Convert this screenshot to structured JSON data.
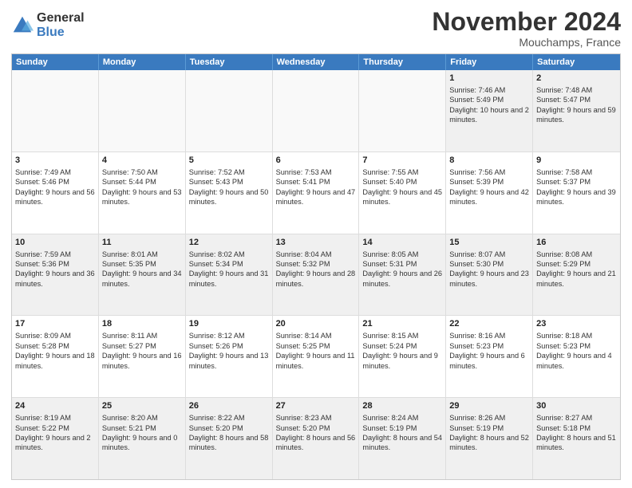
{
  "logo": {
    "general": "General",
    "blue": "Blue"
  },
  "header": {
    "title": "November 2024",
    "subtitle": "Mouchamps, France"
  },
  "calendar": {
    "days": [
      "Sunday",
      "Monday",
      "Tuesday",
      "Wednesday",
      "Thursday",
      "Friday",
      "Saturday"
    ],
    "rows": [
      [
        {
          "day": "",
          "info": "",
          "empty": true
        },
        {
          "day": "",
          "info": "",
          "empty": true
        },
        {
          "day": "",
          "info": "",
          "empty": true
        },
        {
          "day": "",
          "info": "",
          "empty": true
        },
        {
          "day": "",
          "info": "",
          "empty": true
        },
        {
          "day": "1",
          "info": "Sunrise: 7:46 AM\nSunset: 5:49 PM\nDaylight: 10 hours and 2 minutes."
        },
        {
          "day": "2",
          "info": "Sunrise: 7:48 AM\nSunset: 5:47 PM\nDaylight: 9 hours and 59 minutes."
        }
      ],
      [
        {
          "day": "3",
          "info": "Sunrise: 7:49 AM\nSunset: 5:46 PM\nDaylight: 9 hours and 56 minutes."
        },
        {
          "day": "4",
          "info": "Sunrise: 7:50 AM\nSunset: 5:44 PM\nDaylight: 9 hours and 53 minutes."
        },
        {
          "day": "5",
          "info": "Sunrise: 7:52 AM\nSunset: 5:43 PM\nDaylight: 9 hours and 50 minutes."
        },
        {
          "day": "6",
          "info": "Sunrise: 7:53 AM\nSunset: 5:41 PM\nDaylight: 9 hours and 47 minutes."
        },
        {
          "day": "7",
          "info": "Sunrise: 7:55 AM\nSunset: 5:40 PM\nDaylight: 9 hours and 45 minutes."
        },
        {
          "day": "8",
          "info": "Sunrise: 7:56 AM\nSunset: 5:39 PM\nDaylight: 9 hours and 42 minutes."
        },
        {
          "day": "9",
          "info": "Sunrise: 7:58 AM\nSunset: 5:37 PM\nDaylight: 9 hours and 39 minutes."
        }
      ],
      [
        {
          "day": "10",
          "info": "Sunrise: 7:59 AM\nSunset: 5:36 PM\nDaylight: 9 hours and 36 minutes."
        },
        {
          "day": "11",
          "info": "Sunrise: 8:01 AM\nSunset: 5:35 PM\nDaylight: 9 hours and 34 minutes."
        },
        {
          "day": "12",
          "info": "Sunrise: 8:02 AM\nSunset: 5:34 PM\nDaylight: 9 hours and 31 minutes."
        },
        {
          "day": "13",
          "info": "Sunrise: 8:04 AM\nSunset: 5:32 PM\nDaylight: 9 hours and 28 minutes."
        },
        {
          "day": "14",
          "info": "Sunrise: 8:05 AM\nSunset: 5:31 PM\nDaylight: 9 hours and 26 minutes."
        },
        {
          "day": "15",
          "info": "Sunrise: 8:07 AM\nSunset: 5:30 PM\nDaylight: 9 hours and 23 minutes."
        },
        {
          "day": "16",
          "info": "Sunrise: 8:08 AM\nSunset: 5:29 PM\nDaylight: 9 hours and 21 minutes."
        }
      ],
      [
        {
          "day": "17",
          "info": "Sunrise: 8:09 AM\nSunset: 5:28 PM\nDaylight: 9 hours and 18 minutes."
        },
        {
          "day": "18",
          "info": "Sunrise: 8:11 AM\nSunset: 5:27 PM\nDaylight: 9 hours and 16 minutes."
        },
        {
          "day": "19",
          "info": "Sunrise: 8:12 AM\nSunset: 5:26 PM\nDaylight: 9 hours and 13 minutes."
        },
        {
          "day": "20",
          "info": "Sunrise: 8:14 AM\nSunset: 5:25 PM\nDaylight: 9 hours and 11 minutes."
        },
        {
          "day": "21",
          "info": "Sunrise: 8:15 AM\nSunset: 5:24 PM\nDaylight: 9 hours and 9 minutes."
        },
        {
          "day": "22",
          "info": "Sunrise: 8:16 AM\nSunset: 5:23 PM\nDaylight: 9 hours and 6 minutes."
        },
        {
          "day": "23",
          "info": "Sunrise: 8:18 AM\nSunset: 5:23 PM\nDaylight: 9 hours and 4 minutes."
        }
      ],
      [
        {
          "day": "24",
          "info": "Sunrise: 8:19 AM\nSunset: 5:22 PM\nDaylight: 9 hours and 2 minutes."
        },
        {
          "day": "25",
          "info": "Sunrise: 8:20 AM\nSunset: 5:21 PM\nDaylight: 9 hours and 0 minutes."
        },
        {
          "day": "26",
          "info": "Sunrise: 8:22 AM\nSunset: 5:20 PM\nDaylight: 8 hours and 58 minutes."
        },
        {
          "day": "27",
          "info": "Sunrise: 8:23 AM\nSunset: 5:20 PM\nDaylight: 8 hours and 56 minutes."
        },
        {
          "day": "28",
          "info": "Sunrise: 8:24 AM\nSunset: 5:19 PM\nDaylight: 8 hours and 54 minutes."
        },
        {
          "day": "29",
          "info": "Sunrise: 8:26 AM\nSunset: 5:19 PM\nDaylight: 8 hours and 52 minutes."
        },
        {
          "day": "30",
          "info": "Sunrise: 8:27 AM\nSunset: 5:18 PM\nDaylight: 8 hours and 51 minutes."
        }
      ]
    ]
  }
}
